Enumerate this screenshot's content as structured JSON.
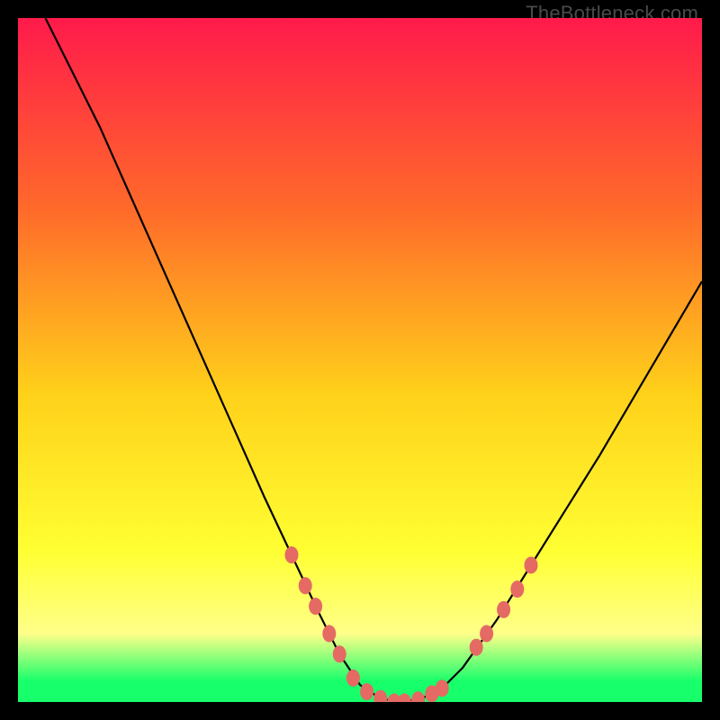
{
  "watermark": "TheBottleneck.com",
  "colors": {
    "frame": "#000000",
    "gradient_top": "#ff1a4b",
    "gradient_mid1": "#ff6a2a",
    "gradient_mid2": "#ffd11a",
    "gradient_mid3": "#ffff33",
    "gradient_bottom_yellow": "#ffff8a",
    "gradient_green": "#17ff6a",
    "curve": "#000000",
    "marker": "#e46a63"
  },
  "chart_data": {
    "type": "line",
    "title": "",
    "xlabel": "",
    "ylabel": "",
    "xlim": [
      0,
      100
    ],
    "ylim": [
      0,
      100
    ],
    "grid": false,
    "legend": false,
    "curve": [
      {
        "x": 4.0,
        "y": 100.0
      },
      {
        "x": 8.0,
        "y": 92.0
      },
      {
        "x": 12.0,
        "y": 84.0
      },
      {
        "x": 16.0,
        "y": 75.0
      },
      {
        "x": 20.0,
        "y": 66.0
      },
      {
        "x": 24.0,
        "y": 57.0
      },
      {
        "x": 28.0,
        "y": 48.0
      },
      {
        "x": 32.0,
        "y": 39.0
      },
      {
        "x": 36.0,
        "y": 30.0
      },
      {
        "x": 40.0,
        "y": 21.5
      },
      {
        "x": 44.0,
        "y": 13.0
      },
      {
        "x": 47.0,
        "y": 7.0
      },
      {
        "x": 50.0,
        "y": 2.5
      },
      {
        "x": 53.0,
        "y": 0.5
      },
      {
        "x": 56.0,
        "y": 0.0
      },
      {
        "x": 59.0,
        "y": 0.5
      },
      {
        "x": 62.0,
        "y": 2.0
      },
      {
        "x": 65.0,
        "y": 5.0
      },
      {
        "x": 70.0,
        "y": 12.0
      },
      {
        "x": 75.0,
        "y": 20.0
      },
      {
        "x": 80.0,
        "y": 28.0
      },
      {
        "x": 85.0,
        "y": 36.0
      },
      {
        "x": 90.0,
        "y": 44.5
      },
      {
        "x": 95.0,
        "y": 53.0
      },
      {
        "x": 100.0,
        "y": 61.5
      }
    ],
    "markers": [
      {
        "x": 40.0,
        "y": 21.5
      },
      {
        "x": 42.0,
        "y": 17.0
      },
      {
        "x": 43.5,
        "y": 14.0
      },
      {
        "x": 45.5,
        "y": 10.0
      },
      {
        "x": 47.0,
        "y": 7.0
      },
      {
        "x": 49.0,
        "y": 3.5
      },
      {
        "x": 51.0,
        "y": 1.5
      },
      {
        "x": 53.0,
        "y": 0.5
      },
      {
        "x": 55.0,
        "y": 0.0
      },
      {
        "x": 56.5,
        "y": 0.0
      },
      {
        "x": 58.5,
        "y": 0.3
      },
      {
        "x": 60.5,
        "y": 1.2
      },
      {
        "x": 62.0,
        "y": 2.0
      },
      {
        "x": 67.0,
        "y": 8.0
      },
      {
        "x": 68.5,
        "y": 10.0
      },
      {
        "x": 71.0,
        "y": 13.5
      },
      {
        "x": 73.0,
        "y": 16.5
      },
      {
        "x": 75.0,
        "y": 20.0
      }
    ]
  }
}
